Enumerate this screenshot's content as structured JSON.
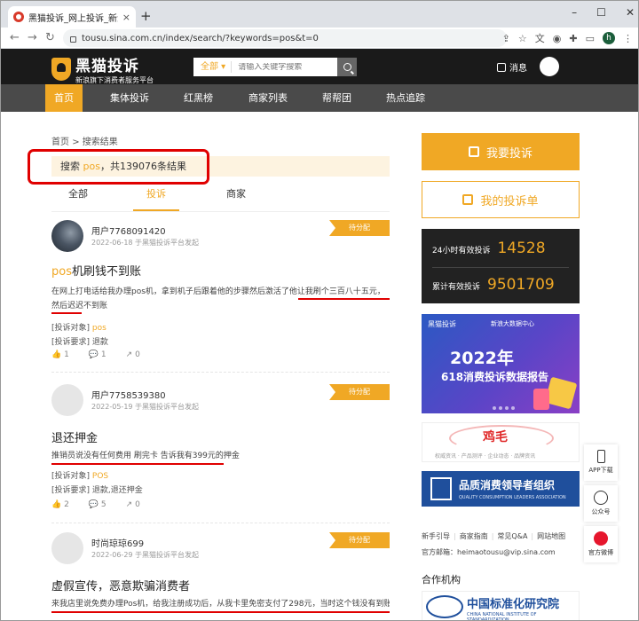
{
  "browser": {
    "tab_title": "黑猫投诉_网上投诉_新浪旗下消费",
    "tab_close": "×",
    "new_tab": "+",
    "url": "tousu.sina.com.cn/index/search/?keywords=pos&t=0",
    "profile_initial": "h"
  },
  "header": {
    "logo_name": "黑猫投诉",
    "logo_slogan": "新浪旗下消费者服务平台",
    "search_category": "全部 ▾",
    "search_placeholder": "请输入关键字搜索",
    "messages_label": "消息"
  },
  "nav": {
    "items": [
      {
        "label": "首页",
        "active": true
      },
      {
        "label": "集体投诉",
        "active": false
      },
      {
        "label": "红黑榜",
        "active": false
      },
      {
        "label": "商家列表",
        "active": false
      },
      {
        "label": "帮帮团",
        "active": false
      },
      {
        "label": "热点追踪",
        "active": false
      }
    ]
  },
  "breadcrumb": {
    "home": "首页",
    "sep": ">",
    "current": "搜索结果"
  },
  "result": {
    "prefix": "搜索",
    "keyword": "pos",
    "suffix": "，共139076条结果"
  },
  "tabs": [
    "全部",
    "投诉",
    "商家"
  ],
  "complaints": [
    {
      "user": "用户7768091420",
      "date": "2022-06-18 于黑猫投诉平台发起",
      "status": "待分配",
      "title_highlight": "pos",
      "title_rest": "机刷钱不到账",
      "body": "在网上打电话给我办理pos机，拿到机子后跟着他的步骤然后激活了他让我刷个三百八十五元，然后迟迟不到账",
      "target_label": "[投诉对象]",
      "target_value": "pos",
      "request_label": "[投诉要求]",
      "request_value": "退款",
      "likes": "1",
      "comments": "1",
      "shares": "0"
    },
    {
      "user": "用户7758539380",
      "date": "2022-05-19 于黑猫投诉平台发起",
      "status": "待分配",
      "title_highlight": "",
      "title_rest": "退还押金",
      "body": "推销员说没有任何费用 刷完卡 告诉我有399元的押金",
      "target_label": "[投诉对象]",
      "target_value": "POS",
      "request_label": "[投诉要求]",
      "request_value": "退款,退还押金",
      "likes": "2",
      "comments": "5",
      "shares": "0"
    },
    {
      "user": "时尚琼琼699",
      "date": "2022-06-29 于黑猫投诉平台发起",
      "status": "待分配",
      "title_highlight": "",
      "title_rest": "虚假宣传，恶意欺骗消费者",
      "body": "来我店里说免费办理Pos机，给我注册成功后，从我卡里免密支付了298元，当时这个钱没有到账，说"
    }
  ],
  "sidebar": {
    "complain_button": "我要投诉",
    "my_list_button": "我的投诉单",
    "valid_24h_label": "24小时有效投诉",
    "valid_24h_value": "14528",
    "valid_total_label": "累计有效投诉",
    "valid_total_value": "9501709",
    "banner_logo": "黑猫投诉",
    "banner_partner": "新浪大数据中心",
    "banner_year": "2022年",
    "banner_title": "618消费投诉数据报告",
    "ad_name": "鸡毛",
    "ad_sub": "权威资讯 · 产品测评 · 企业动态 · 品牌资讯",
    "quality_title": "品质消费领导者组织",
    "quality_sub": "QUALITY CONSUMPTION LEADERS ASSOCIATION",
    "footer_links": [
      "新手引导",
      "商家指南",
      "常见Q&A",
      "网站地图"
    ],
    "email": "官方邮箱：heimaotousu@vip.sina.com",
    "partners_title": "合作机构",
    "cnis_cn": "中国标准化研究院",
    "cnis_en": "CHINA NATIONAL INSTITUTE OF STANDARDIZATION"
  },
  "float": {
    "app": "APP下载",
    "wechat": "公众号",
    "weibo": "官方微博"
  },
  "colors": {
    "accent": "#f0a825",
    "annotation_red": "#e00000",
    "header_bg": "#1a1a1a",
    "nav_bg": "#4a4a4a"
  }
}
